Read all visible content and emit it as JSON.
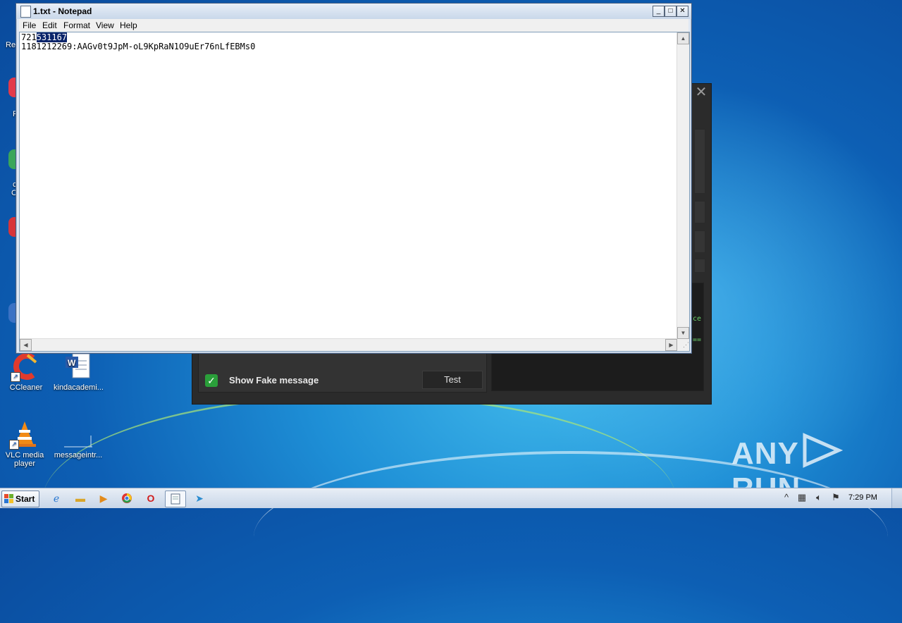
{
  "desktop": {
    "partial_labels": [
      "Re",
      "F",
      "c",
      "C"
    ],
    "icons": [
      {
        "label": "CCleaner",
        "icon": "ccleaner-icon"
      },
      {
        "label": "kindacademi...",
        "icon": "word-document-icon"
      },
      {
        "label": "VLC media player",
        "icon": "vlc-cone-icon"
      },
      {
        "label": "messageintr...",
        "icon": "blank-file-icon"
      }
    ]
  },
  "background_app": {
    "close_icon": "close-icon",
    "show_fake_message_label": "Show Fake message",
    "show_fake_message_checked": true,
    "test_button_label": "Test",
    "code_fragments": [
      "ce",
      "=="
    ],
    "check_color": "#2a9f3a"
  },
  "notepad": {
    "title": "1.txt - Notepad",
    "menu": [
      "File",
      "Edit",
      "Format",
      "View",
      "Help"
    ],
    "line1_prefix": "721",
    "line1_selected": "531167",
    "line2": "1181212269:AAGv0t9JpM-oL9KpRaN1O9uEr76nLfEBMs0",
    "selection_color": "#0a246a"
  },
  "watermark": {
    "left": "ANY",
    "right": "RUN"
  },
  "taskbar": {
    "start_label": "Start",
    "clock": "7:29 PM",
    "buttons": [
      "internet-explorer-icon",
      "folder-icon",
      "media-player-icon",
      "chrome-icon",
      "opera-icon",
      "notepad-icon",
      "telegram-icon"
    ],
    "tray": [
      "show-hidden-icons-icon",
      "network-icon",
      "volume-icon",
      "action-center-flag-icon"
    ]
  }
}
